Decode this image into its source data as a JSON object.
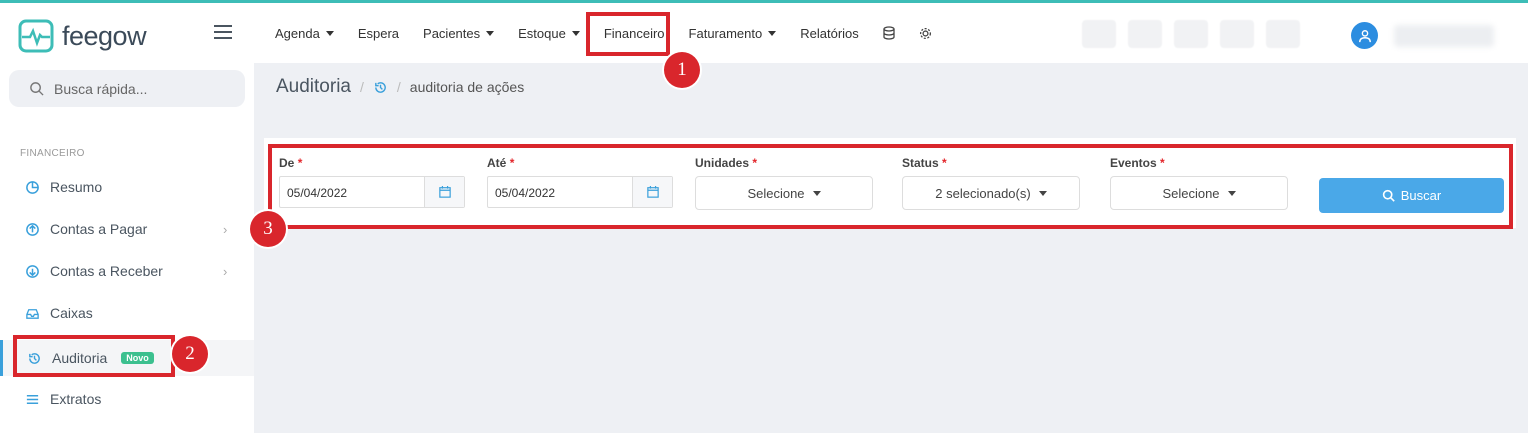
{
  "brand": {
    "name": "feegow",
    "color": "#3dbdb7"
  },
  "sidebar": {
    "search_placeholder": "Busca rápida...",
    "section": "FINANCEIRO",
    "items": [
      {
        "label": "Resumo",
        "icon": "pie-chart-icon"
      },
      {
        "label": "Contas a Pagar",
        "icon": "arrow-up-circle-icon",
        "has_submenu": true
      },
      {
        "label": "Contas a Receber",
        "icon": "arrow-down-circle-icon",
        "has_submenu": true
      },
      {
        "label": "Caixas",
        "icon": "inbox-icon"
      },
      {
        "label": "Auditoria",
        "icon": "history-icon",
        "badge": "Novo",
        "active": true
      },
      {
        "label": "Extratos",
        "icon": "list-icon"
      }
    ]
  },
  "topnav": {
    "items": [
      "Agenda",
      "Espera",
      "Pacientes",
      "Estoque",
      "Financeiro",
      "Faturamento",
      "Relatórios"
    ]
  },
  "breadcrumb": {
    "title": "Auditoria",
    "sub": "auditoria de ações"
  },
  "filters": {
    "de": {
      "label": "De",
      "required": "*",
      "value": "05/04/2022"
    },
    "ate": {
      "label": "Até",
      "required": "*",
      "value": "05/04/2022"
    },
    "unidades": {
      "label": "Unidades",
      "required": "*",
      "value": "Selecione"
    },
    "status": {
      "label": "Status",
      "required": "*",
      "value": "2 selecionado(s)"
    },
    "eventos": {
      "label": "Eventos",
      "required": "*",
      "value": "Selecione"
    },
    "buscar_label": "Buscar"
  },
  "annotations": [
    "1",
    "2",
    "3"
  ],
  "colors": {
    "accent": "#4aa8e8",
    "highlight": "#d9262c",
    "badge": "#3cc08f"
  }
}
